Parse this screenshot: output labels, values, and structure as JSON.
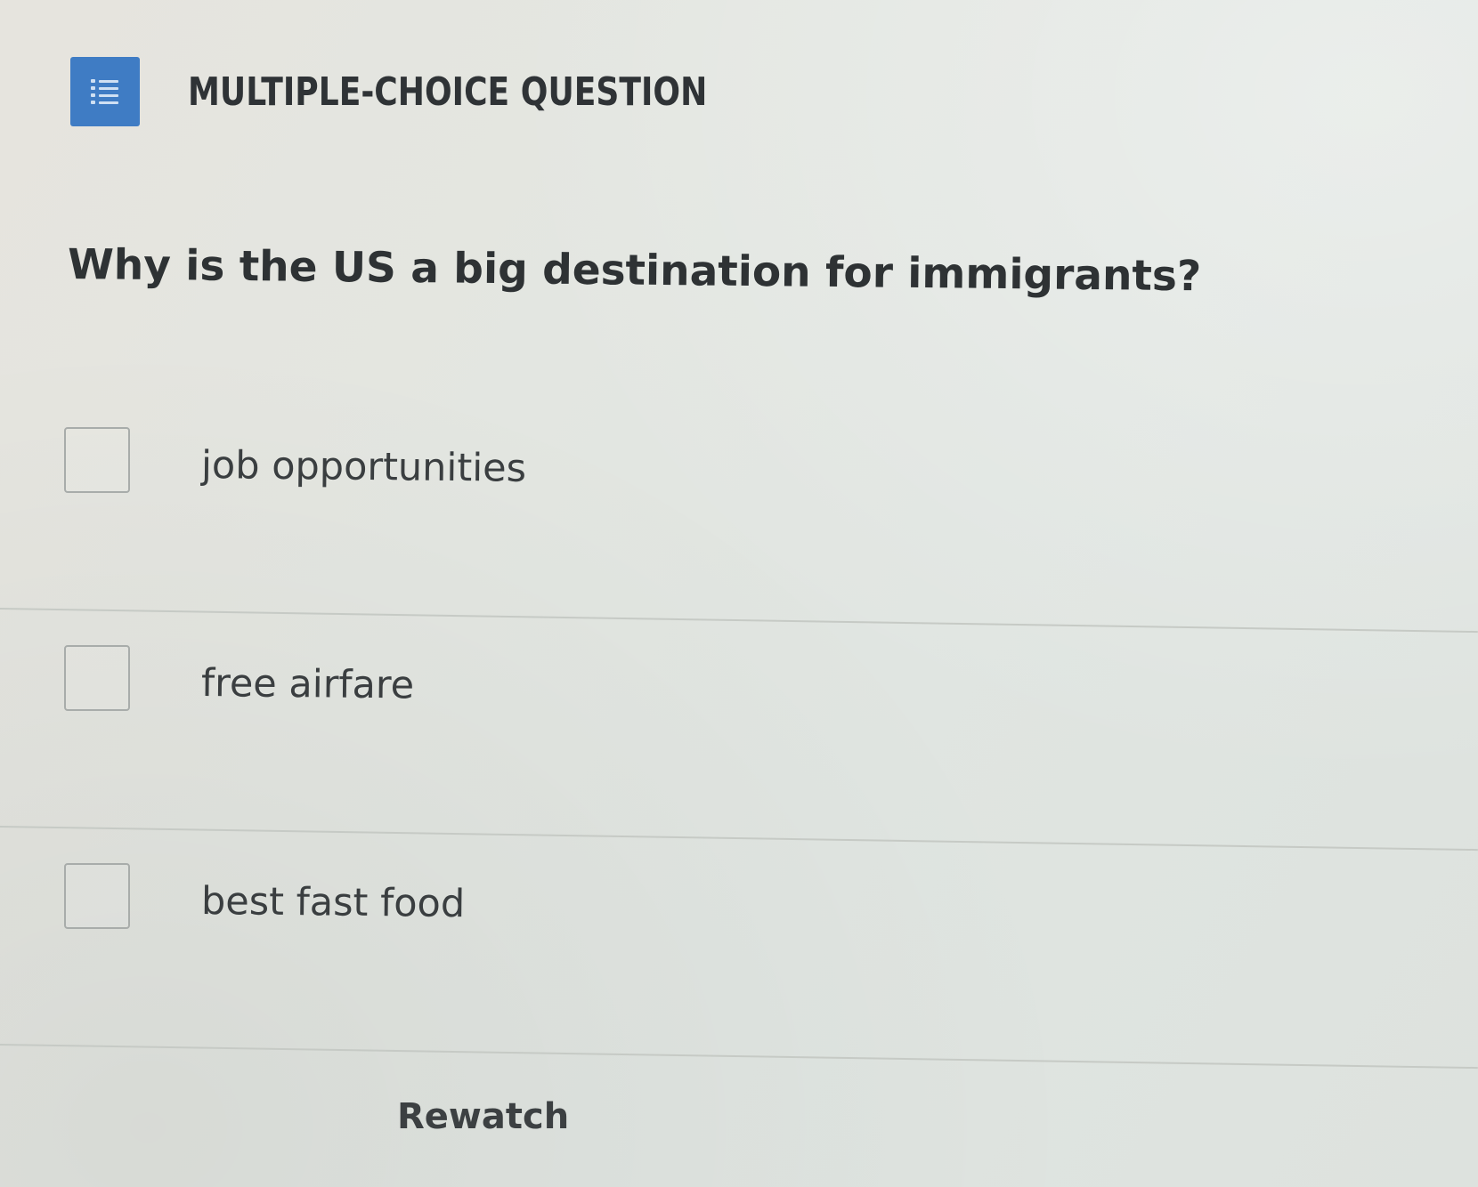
{
  "header": {
    "icon": "numbered-list-icon",
    "icon_color": "#3f7cc4",
    "title": "MULTIPLE-CHOICE QUESTION"
  },
  "question": {
    "text": "Why is the US a big destination for immigrants?"
  },
  "options": [
    {
      "label": "job opportunities",
      "checked": false
    },
    {
      "label": "free airfare",
      "checked": false
    },
    {
      "label": "best fast food",
      "checked": false
    }
  ],
  "footer": {
    "rewatch_label": "Rewatch"
  }
}
